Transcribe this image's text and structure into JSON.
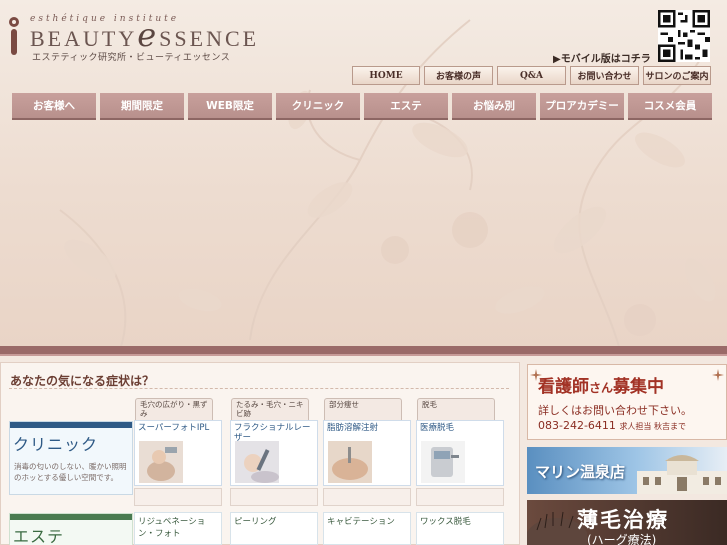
{
  "brand": {
    "tagline": "esthétique institute",
    "name_part1": "BEAUTY",
    "name_e": "e",
    "name_part2": "SSENCE",
    "subtitle": "エステティック研究所・ビューティエッセンス"
  },
  "header": {
    "mobile_link": "▶モバイル版はコチラ"
  },
  "subnav": [
    {
      "label": "HOME"
    },
    {
      "label": "お客様の声"
    },
    {
      "label": "Q&A"
    },
    {
      "label": "お問い合わせ"
    },
    {
      "label": "サロンのご案内"
    }
  ],
  "mainnav": [
    {
      "label": "お客様へ"
    },
    {
      "label": "期間限定"
    },
    {
      "label": "WEB限定"
    },
    {
      "label": "クリニック"
    },
    {
      "label": "エステ"
    },
    {
      "label": "お悩み別"
    },
    {
      "label": "プロアカデミー"
    },
    {
      "label": "コスメ会員"
    }
  ],
  "symptoms": {
    "heading": "あなたの気になる症状は？",
    "tabs": [
      {
        "label": "毛穴の広がり・黒ずみ"
      },
      {
        "label": "たるみ・毛穴・ニキビ跡"
      },
      {
        "label": "部分痩せ"
      },
      {
        "label": "脱毛"
      }
    ],
    "clinic": {
      "title": "クリニック",
      "desc": "消毒の匂いのしない、暖かい照明のホッとする優しい空間です。",
      "services": [
        {
          "name": "スーパーフォトIPL"
        },
        {
          "name": "フラクショナルレーザー"
        },
        {
          "name": "脂肪溶解注射"
        },
        {
          "name": "医療脱毛"
        }
      ]
    },
    "esthe": {
      "title": "エステ",
      "services": [
        {
          "name": "リジュベネーション・フォト"
        },
        {
          "name": "ピーリング"
        },
        {
          "name": "キャビテーション"
        },
        {
          "name": "ワックス脱毛"
        }
      ]
    }
  },
  "banners": {
    "nurse": {
      "title_main": "看護師",
      "title_small": "さん",
      "title_end": "募集中",
      "line2": "詳しくはお問い合わせ下さい。",
      "phone": "083-242-6411",
      "contact_note": "求人担当 秋吉まで"
    },
    "marine": {
      "label": "マリン温泉店"
    },
    "hair": {
      "label": "薄毛治療",
      "sub": "(ハーグ療法)"
    }
  },
  "colors": {
    "nav_bg": "#c09894",
    "clinic_accent": "#2f5a86",
    "esthe_accent": "#4a7a50",
    "hero_band": "#9a6a68"
  }
}
